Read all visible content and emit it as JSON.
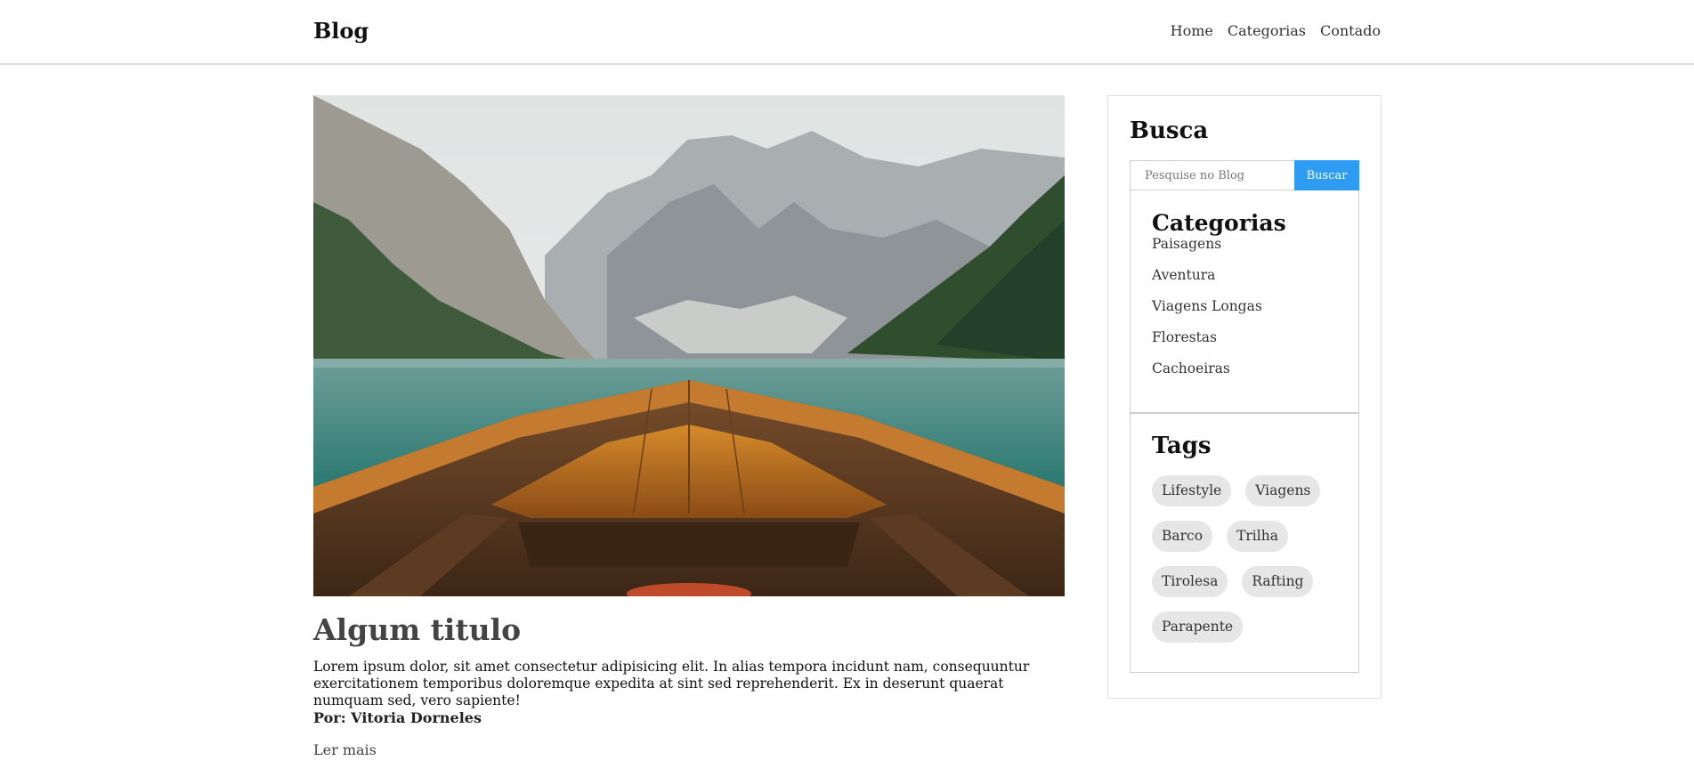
{
  "header": {
    "brand": "Blog",
    "nav": [
      "Home",
      "Categorias",
      "Contado"
    ]
  },
  "post": {
    "title": "Algum titulo",
    "text": "Lorem ipsum dolor, sit amet consectetur adipisicing elit. In alias tempora incidunt nam, consequuntur exercitationem temporibus doloremque expedita at sint sed reprehenderit. Ex in deserunt quaerat numquam sed, vero sapiente!",
    "author": "Por: Vitoria Dorneles",
    "read_more": "Ler mais",
    "image_icon": "lake-boat-landscape-image"
  },
  "sidebar": {
    "search": {
      "title": "Busca",
      "placeholder": "Pesquise no Blog",
      "button": "Buscar",
      "button_color": "#2f9cf4"
    },
    "categories": {
      "title": "Categorias",
      "items": [
        "Paisagens",
        "Aventura",
        "Viagens Longas",
        "Florestas",
        "Cachoeiras"
      ]
    },
    "tags": {
      "title": "Tags",
      "items": [
        "Lifestyle",
        "Viagens",
        "Barco",
        "Trilha",
        "Tirolesa",
        "Rafting",
        "Parapente"
      ]
    }
  }
}
